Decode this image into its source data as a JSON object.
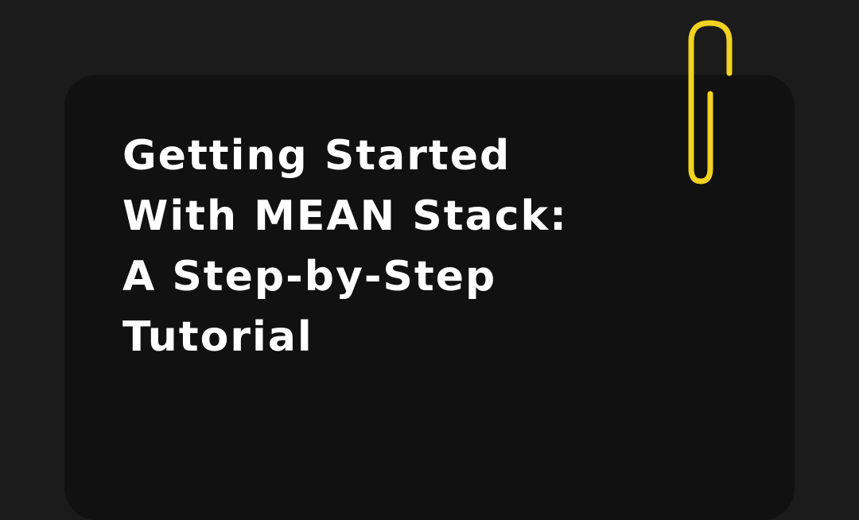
{
  "title": {
    "lines": [
      "Getting Started",
      "With MEAN Stack:",
      "A Step-by-Step",
      "Tutorial"
    ]
  },
  "decoration": {
    "icon": "paperclip-icon",
    "color": "#f2d21f"
  },
  "colors": {
    "background": "#1b1b1b",
    "card": "#111111",
    "text": "#ffffff"
  }
}
